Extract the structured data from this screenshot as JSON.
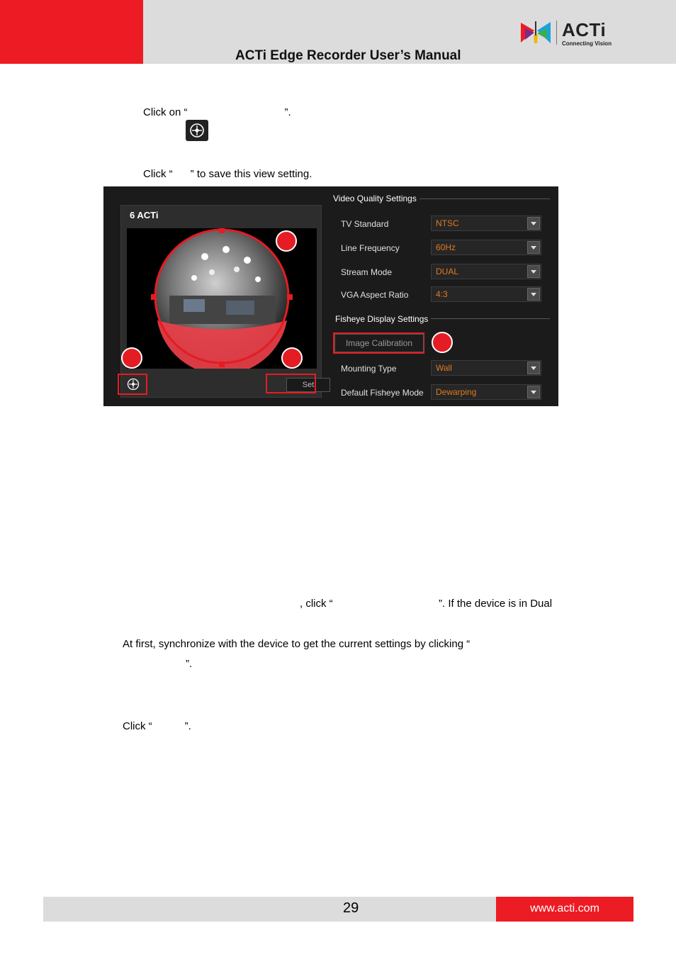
{
  "header": {
    "title": "ACTi Edge Recorder User’s Manual",
    "logo_word": "ACTi",
    "logo_tagline": "Connecting Vision",
    "colors": {
      "brand_red": "#ed1c24",
      "band_gray": "#dcdcdc"
    }
  },
  "body": {
    "line1_prefix": "Click on “",
    "line1_suffix": "”.",
    "line2_prefix": "Click “",
    "line2_suffix": "” to save this view setting.",
    "para1_left": ", click “",
    "para1_right": "”. If the device is in Dual",
    "para2_line1": "At first, synchronize with the device to get the current settings by clicking “",
    "para2_line2": "”.",
    "para3_prefix": "Click “",
    "para3_suffix": "”."
  },
  "screenshot": {
    "camera_title": "6 ACTi",
    "set_button": "Set",
    "video_quality_title": "Video Quality Settings",
    "fisheye_title": "Fisheye Display Settings",
    "calibration_button": "Image Calibration",
    "fields": [
      {
        "label": "TV Standard",
        "value": "NTSC"
      },
      {
        "label": "Line Frequency",
        "value": "60Hz"
      },
      {
        "label": "Stream Mode",
        "value": "DUAL"
      },
      {
        "label": "VGA Aspect Ratio",
        "value": "4:3"
      },
      {
        "label": "Mounting Type",
        "value": "Wall"
      },
      {
        "label": "Default Fisheye Mode",
        "value": "Dewarping"
      }
    ],
    "icons": [
      "crosshair-icon"
    ],
    "colors": {
      "highlight_red": "#e51c23",
      "value_orange": "#e07a1f"
    }
  },
  "footer": {
    "page_number": "29",
    "url": "www.acti.com"
  }
}
